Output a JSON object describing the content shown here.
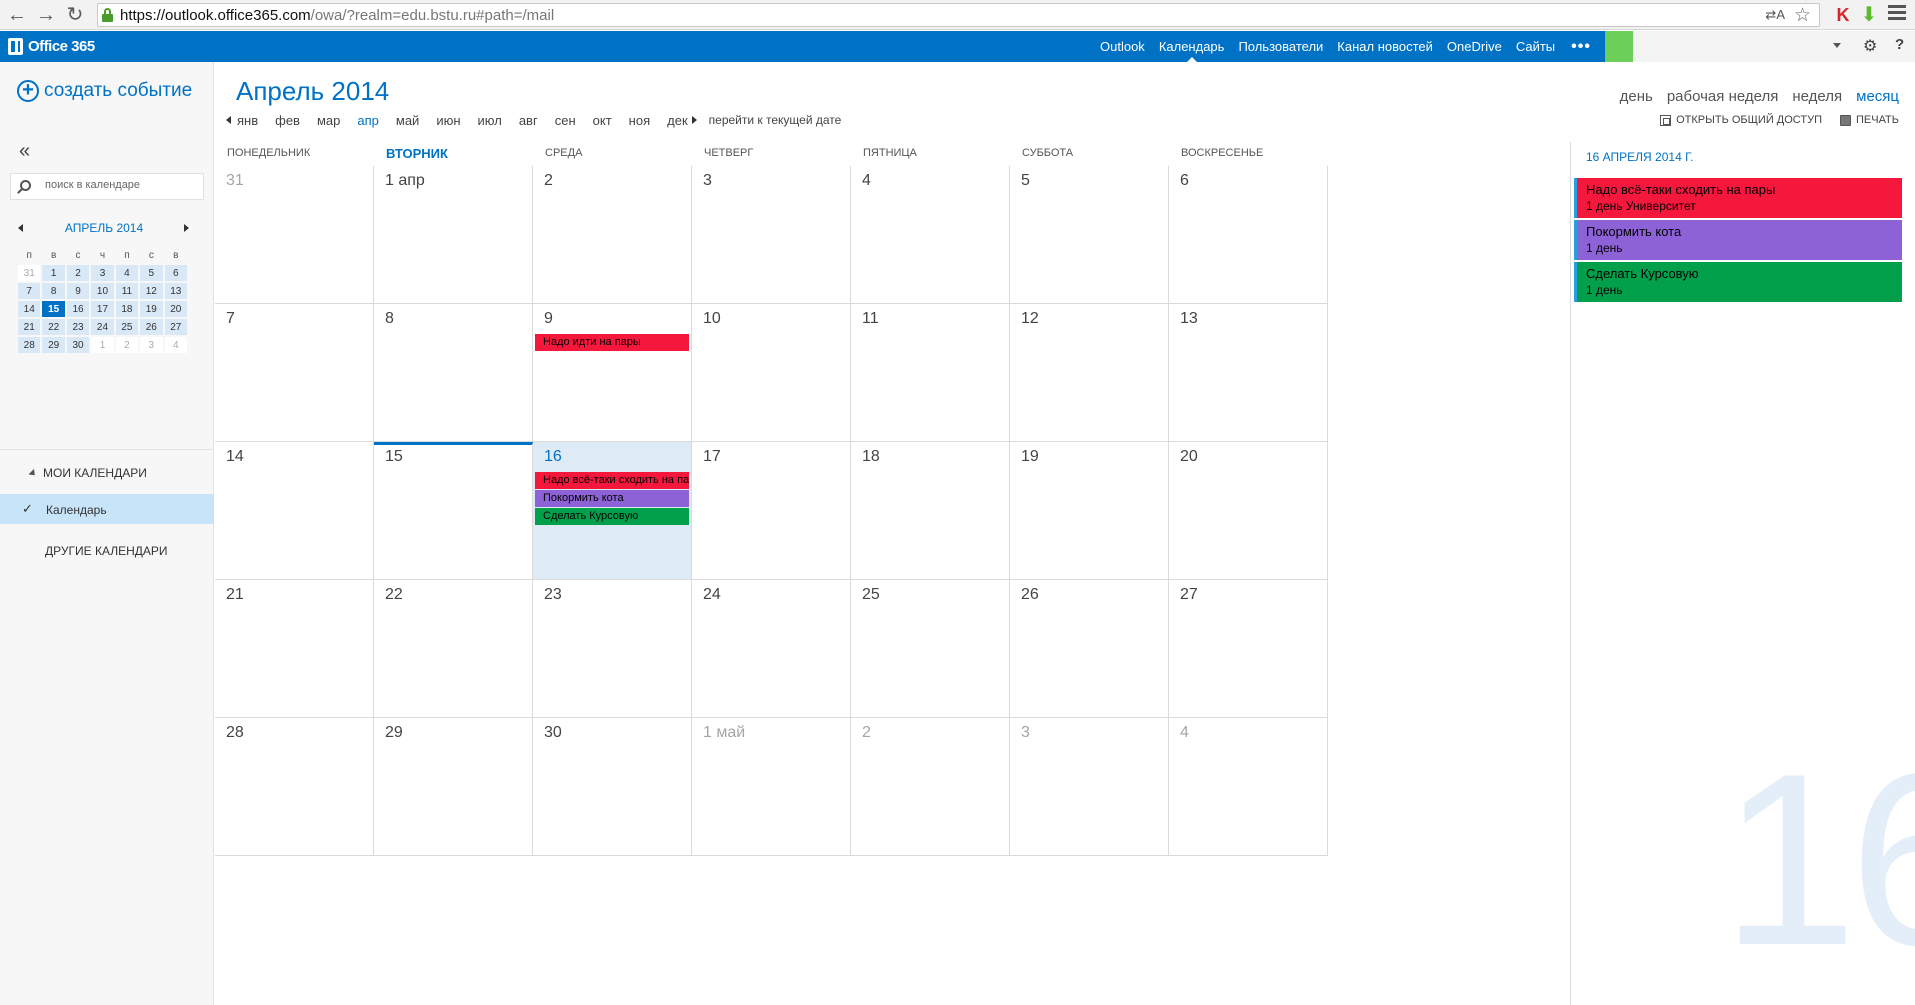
{
  "browser": {
    "url_host": "https://outlook.office365.com",
    "url_path": "/owa/?realm=edu.bstu.ru#path=/mail",
    "translate_icon": "translate-icon",
    "star_icon": "star-icon"
  },
  "suite": {
    "brand": "Office 365",
    "links": [
      "Outlook",
      "Календарь",
      "Пользователи",
      "Канал новостей",
      "OneDrive",
      "Сайты"
    ],
    "active_link": "Календарь",
    "more": "•••"
  },
  "left": {
    "new_event": "создать событие",
    "search_placeholder": "поиск в календаре",
    "mini_title": "апрель 2014",
    "weekdays": [
      "п",
      "в",
      "с",
      "ч",
      "п",
      "с",
      "в"
    ],
    "mini_weeks": [
      [
        {
          "d": "31",
          "o": true
        },
        {
          "d": "1"
        },
        {
          "d": "2"
        },
        {
          "d": "3"
        },
        {
          "d": "4"
        },
        {
          "d": "5"
        },
        {
          "d": "6"
        }
      ],
      [
        {
          "d": "7"
        },
        {
          "d": "8"
        },
        {
          "d": "9"
        },
        {
          "d": "10"
        },
        {
          "d": "11"
        },
        {
          "d": "12"
        },
        {
          "d": "13"
        }
      ],
      [
        {
          "d": "14"
        },
        {
          "d": "15",
          "t": true
        },
        {
          "d": "16"
        },
        {
          "d": "17"
        },
        {
          "d": "18"
        },
        {
          "d": "19"
        },
        {
          "d": "20"
        }
      ],
      [
        {
          "d": "21"
        },
        {
          "d": "22"
        },
        {
          "d": "23"
        },
        {
          "d": "24"
        },
        {
          "d": "25"
        },
        {
          "d": "26"
        },
        {
          "d": "27"
        }
      ],
      [
        {
          "d": "28"
        },
        {
          "d": "29"
        },
        {
          "d": "30"
        },
        {
          "d": "1",
          "o": true
        },
        {
          "d": "2",
          "o": true
        },
        {
          "d": "3",
          "o": true
        },
        {
          "d": "4",
          "o": true
        }
      ]
    ],
    "my_calendars": "МОИ КАЛЕНДАРИ",
    "calendar_name": "Календарь",
    "other_calendars": "ДРУГИЕ КАЛЕНДАРИ"
  },
  "header": {
    "month_title": "Апрель 2014",
    "months": [
      "янв",
      "фев",
      "мар",
      "апр",
      "май",
      "июн",
      "июл",
      "авг",
      "сен",
      "окт",
      "ноя",
      "дек"
    ],
    "active_month": "апр",
    "goto_today": "перейти к текущей дате",
    "views": [
      "день",
      "рабочая неделя",
      "неделя",
      "месяц"
    ],
    "active_view": "месяц",
    "share": "ОТКРЫТЬ ОБЩИЙ ДОСТУП",
    "print": "ПЕЧАТЬ"
  },
  "grid": {
    "dow": [
      "понедельник",
      "вторник",
      "среда",
      "четверг",
      "пятница",
      "суббота",
      "воскресенье"
    ],
    "today_dow_index": 1,
    "weeks": [
      [
        {
          "d": "31",
          "o": true
        },
        {
          "d": "1 апр"
        },
        {
          "d": "2"
        },
        {
          "d": "3"
        },
        {
          "d": "4"
        },
        {
          "d": "5"
        },
        {
          "d": "6"
        }
      ],
      [
        {
          "d": "7"
        },
        {
          "d": "8"
        },
        {
          "d": "9",
          "ev": [
            0
          ]
        },
        {
          "d": "10"
        },
        {
          "d": "11"
        },
        {
          "d": "12"
        },
        {
          "d": "13"
        }
      ],
      [
        {
          "d": "14"
        },
        {
          "d": "15",
          "bar": true
        },
        {
          "d": "16",
          "sel": true,
          "ev": [
            1,
            2,
            3
          ]
        },
        {
          "d": "17"
        },
        {
          "d": "18"
        },
        {
          "d": "19"
        },
        {
          "d": "20"
        }
      ],
      [
        {
          "d": "21"
        },
        {
          "d": "22"
        },
        {
          "d": "23"
        },
        {
          "d": "24"
        },
        {
          "d": "25"
        },
        {
          "d": "26"
        },
        {
          "d": "27"
        }
      ],
      [
        {
          "d": "28"
        },
        {
          "d": "29"
        },
        {
          "d": "30"
        },
        {
          "d": "1 май",
          "o": true
        },
        {
          "d": "2",
          "o": true
        },
        {
          "d": "3",
          "o": true
        },
        {
          "d": "4",
          "o": true
        }
      ]
    ],
    "events": [
      {
        "title": "Надо идти на пары",
        "color": "#f6173c"
      },
      {
        "title": "Надо всё-таки сходить на пары",
        "color": "#f6173c"
      },
      {
        "title": "Покормить кота",
        "color": "#8e62d7"
      },
      {
        "title": "Сделать Курсовую",
        "color": "#03a04c"
      }
    ]
  },
  "agenda": {
    "date": "16 апреля 2014 г.",
    "items": [
      {
        "title": "Надо всё-таки сходить на пары",
        "sub": "1 день Университет",
        "color": "#f6173c"
      },
      {
        "title": "Покормить кота",
        "sub": "1 день",
        "color": "#8e62d7"
      },
      {
        "title": "Сделать Курсовую",
        "sub": "1 день",
        "color": "#03a04c"
      }
    ],
    "big_day": "16"
  }
}
